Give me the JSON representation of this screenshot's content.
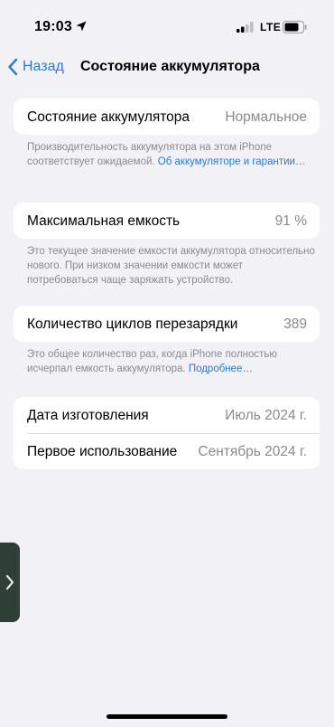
{
  "status_bar": {
    "time": "19:03",
    "network": "LTE"
  },
  "nav": {
    "back_label": "Назад",
    "title": "Состояние аккумулятора"
  },
  "battery_health": {
    "label": "Состояние аккумулятора",
    "value": "Нормальное",
    "note_text": "Производительность аккумулятора на этом iPhone соответствует ожидаемой. ",
    "note_link": "Об аккумуляторе и гарантии…"
  },
  "max_capacity": {
    "label": "Максимальная емкость",
    "value": "91 %",
    "note_text": "Это текущее значение емкости аккумулятора относительно нового. При низком значении емкости может потребоваться чаще заряжать устройство."
  },
  "cycle_count": {
    "label": "Количество циклов перезарядки",
    "value": "389",
    "note_text": "Это общее количество раз, когда iPhone полностью исчерпал емкость аккумулятора. ",
    "note_link": "Подробнее…"
  },
  "dates": {
    "manufacture_label": "Дата изготовления",
    "manufacture_value": "Июль 2024 г.",
    "first_use_label": "Первое использование",
    "first_use_value": "Сентябрь 2024 г."
  },
  "colors": {
    "accent": "#2a7ad6",
    "background": "#f1f1f6",
    "secondary_text": "#8a8a8f"
  },
  "icons": [
    "location-arrow-icon",
    "cellular-signal-icon",
    "battery-icon",
    "chevron-left-icon",
    "chevron-right-icon"
  ]
}
